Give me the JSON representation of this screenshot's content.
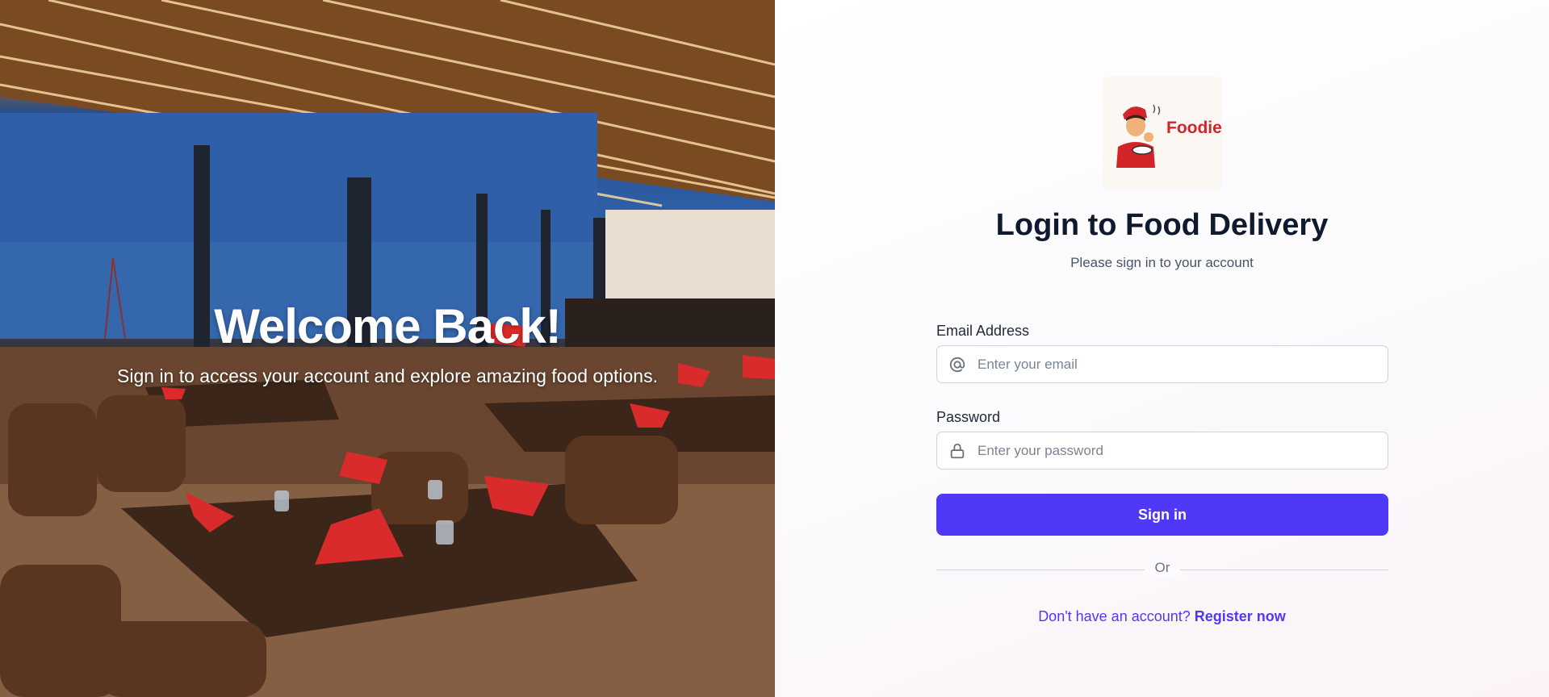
{
  "hero": {
    "title": "Welcome Back!",
    "subtitle": "Sign in to access your account and explore amazing food options."
  },
  "logo": {
    "text": "Foodie",
    "icon": "chef-mascot-icon"
  },
  "login": {
    "title": "Login to Food Delivery",
    "subtitle": "Please sign in to your account",
    "email_label": "Email Address",
    "email_placeholder": "Enter your email",
    "password_label": "Password",
    "password_placeholder": "Enter your password",
    "signin_label": "Sign in",
    "or_label": "Or",
    "register_prompt": "Don't have an account?",
    "register_link": "Register now"
  },
  "colors": {
    "accent": "#4f39f6",
    "brand": "#d3242a",
    "heading": "#0f1a2e"
  },
  "icons": {
    "email": "at-sign-icon",
    "password": "lock-icon"
  }
}
